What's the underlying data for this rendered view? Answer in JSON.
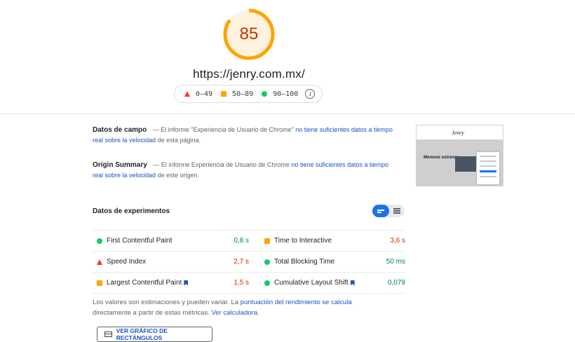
{
  "report": {
    "score": "85",
    "score_color": "#ffa400",
    "url": "https://jenry.com.mx/",
    "legend": [
      {
        "range": "0–49",
        "shape": "triangle",
        "color": "#ff3333"
      },
      {
        "range": "50–89",
        "shape": "square",
        "color": "#ffa400"
      },
      {
        "range": "90–100",
        "shape": "circle",
        "color": "#0cce6b"
      }
    ],
    "info_icon": "info-icon"
  },
  "field_data": {
    "title": "Datos de campo",
    "dash": "—",
    "text_before": "El informe \"Experiencia de Usuario de Chrome\"",
    "link": "no tiene suficientes datos a tiempo real sobre la velocidad",
    "text_after": "de esta página."
  },
  "origin_summary": {
    "title": "Origin Summary",
    "dash": "—",
    "text_before": "El informe Experiencia de Usuario de Chrome",
    "link": "no tiene suficientes datos a tiempo real sobre la velocidad",
    "text_after": "de este origen."
  },
  "screenshot": {
    "brand": "Jenry",
    "hero_text": "Mereces estrenar"
  },
  "lab": {
    "title": "Datos de experimentos",
    "metrics": [
      [
        {
          "name": "First Contentful Paint",
          "value": "0,8 s",
          "status": "green",
          "flag": false
        },
        {
          "name": "Time to Interactive",
          "value": "3,6 s",
          "status": "orange",
          "flag": false
        }
      ],
      [
        {
          "name": "Speed Index",
          "value": "2,7 s",
          "status": "red",
          "flag": false
        },
        {
          "name": "Total Blocking Time",
          "value": "50 ms",
          "status": "green",
          "flag": false
        }
      ],
      [
        {
          "name": "Largest Contentful Paint",
          "value": "1,5 s",
          "status": "orange",
          "flag": true
        },
        {
          "name": "Cumulative Layout Shift",
          "value": "0,079",
          "status": "green",
          "flag": true
        }
      ]
    ],
    "note_before": "Los valores son estimaciones y pueden variar. La",
    "note_link": "puntuación del rendimiento se calcula",
    "note_middle": "directamente a partir de estas métricas.",
    "note_link2": "Ver calculadora",
    "note_end": ".",
    "treemap_button": "VER GRÁFICO DE RECTÁNGULOS"
  }
}
